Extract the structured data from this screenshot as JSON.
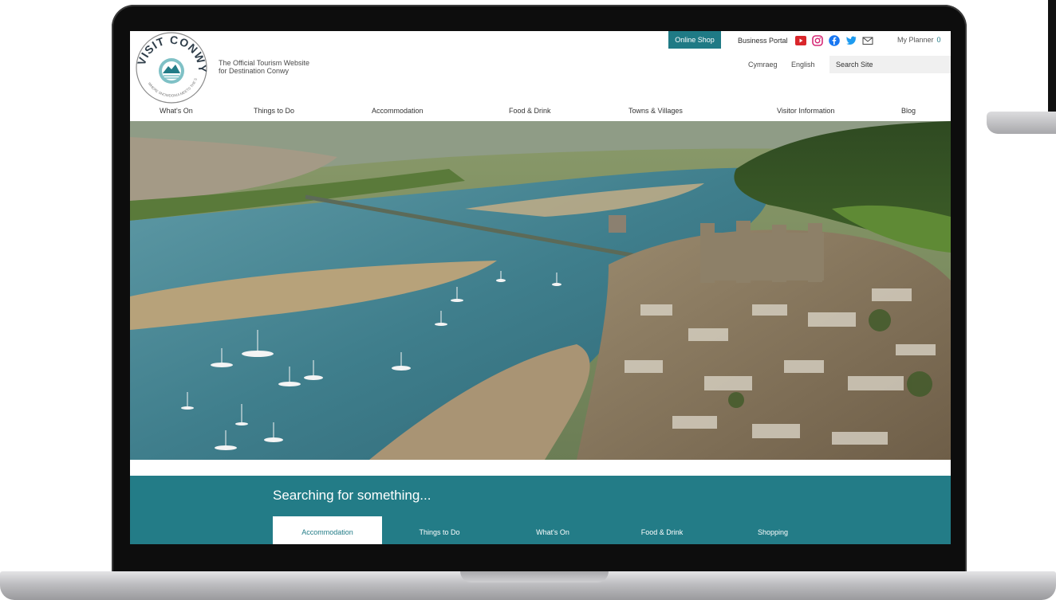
{
  "site": {
    "tagline_line1": "The Official Tourism Website",
    "tagline_line2": "for Destination Conwy",
    "logo_text": "VISIT CONWY",
    "logo_subtext": "WHERE SNOWDONIA MEETS THE SEA"
  },
  "topbar": {
    "online_shop": "Online Shop",
    "business_portal": "Business Portal",
    "social_icons": [
      "youtube-icon",
      "instagram-icon",
      "facebook-icon",
      "twitter-icon",
      "mail-icon"
    ],
    "my_planner": "My Planner",
    "planner_count": "0",
    "lang_cymraeg": "Cymraeg",
    "lang_english": "English",
    "search_placeholder": "Search Site"
  },
  "nav": {
    "items": [
      {
        "label": "What's On"
      },
      {
        "label": "Things to Do"
      },
      {
        "label": "Accommodation"
      },
      {
        "label": "Food & Drink"
      },
      {
        "label": "Towns & Villages"
      },
      {
        "label": "Visitor Information"
      },
      {
        "label": "Blog"
      }
    ]
  },
  "search_section": {
    "heading": "Searching for something...",
    "tabs": [
      {
        "label": "Accommodation",
        "active": true
      },
      {
        "label": "Things to Do",
        "active": false
      },
      {
        "label": "What's On",
        "active": false
      },
      {
        "label": "Food & Drink",
        "active": false
      },
      {
        "label": "Shopping",
        "active": false
      }
    ]
  },
  "colors": {
    "brand_teal": "#237c87",
    "shop_button": "#1f7a85"
  }
}
